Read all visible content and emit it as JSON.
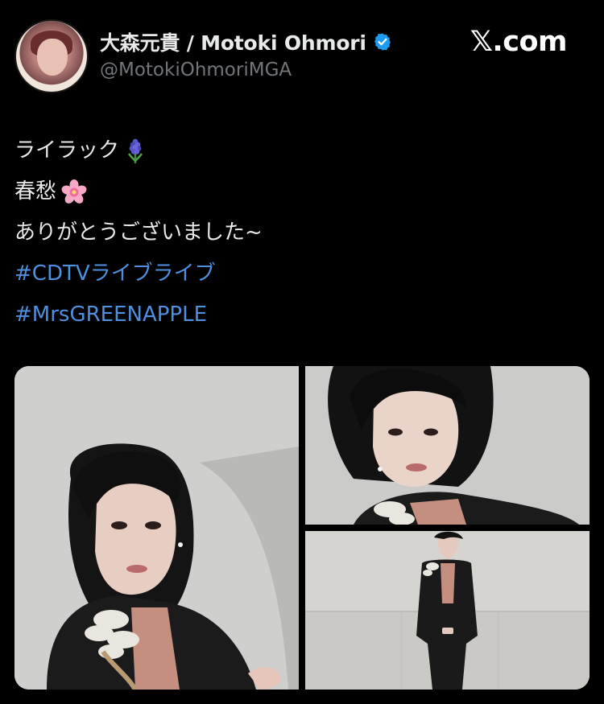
{
  "header": {
    "display_name": "大森元貴 / Motoki Ohmori",
    "handle": "@MotokiOhmoriMGA",
    "verified": true,
    "brand": "𝕏.com"
  },
  "tweet": {
    "lines": [
      {
        "text": "ライラック",
        "emoji": "hyacinth"
      },
      {
        "text": "春愁",
        "emoji": "cherry-blossom"
      },
      {
        "text": "ありがとうございました~"
      },
      {
        "text": "#CDTVライブライブ",
        "hashtag": true
      },
      {
        "text": "#MrsGREENAPPLE",
        "hashtag": true
      }
    ]
  },
  "media": {
    "count": 3,
    "photos": [
      "photo-1",
      "photo-2",
      "photo-3"
    ]
  },
  "colors": {
    "background": "#000000",
    "text": "#e7e9ea",
    "muted": "#71767b",
    "hashtag": "#4e8fde",
    "verified": "#1d9bf0"
  }
}
